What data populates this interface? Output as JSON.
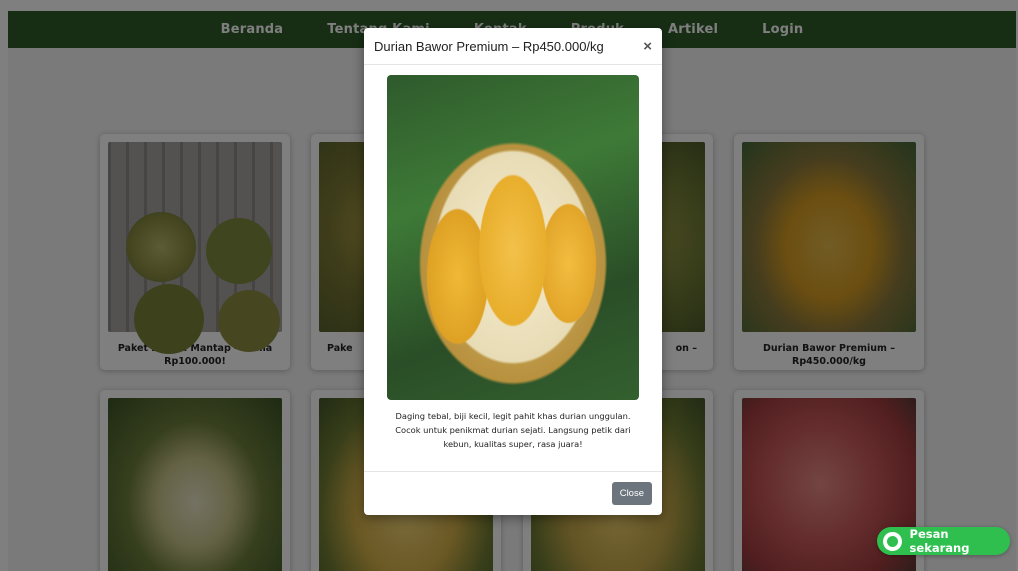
{
  "nav": {
    "items": [
      "Beranda",
      "Tentang Kami",
      "Kontak",
      "Produk",
      "Artikel",
      "Login"
    ]
  },
  "products": [
    {
      "title": "Paket Durian Mantap – Cuma Rp100.000!"
    },
    {
      "title": "Pake"
    },
    {
      "title": "on –"
    },
    {
      "title": "Durian Bawor Premium – Rp450.000/kg"
    }
  ],
  "modal": {
    "title": "Durian Bawor Premium – Rp450.000/kg",
    "close_symbol": "×",
    "description": "Daging tebal, biji kecil, legit pahit khas durian unggulan. Cocok untuk penikmat durian sejati. Langsung petik dari kebun, kualitas super, rasa juara!",
    "close_button": "Close"
  },
  "whatsapp": {
    "label": "Pesan sekarang"
  },
  "colors": {
    "navbar": "#2e5d2b",
    "whatsapp": "#2fbf4f",
    "close_button": "#6c757d"
  }
}
